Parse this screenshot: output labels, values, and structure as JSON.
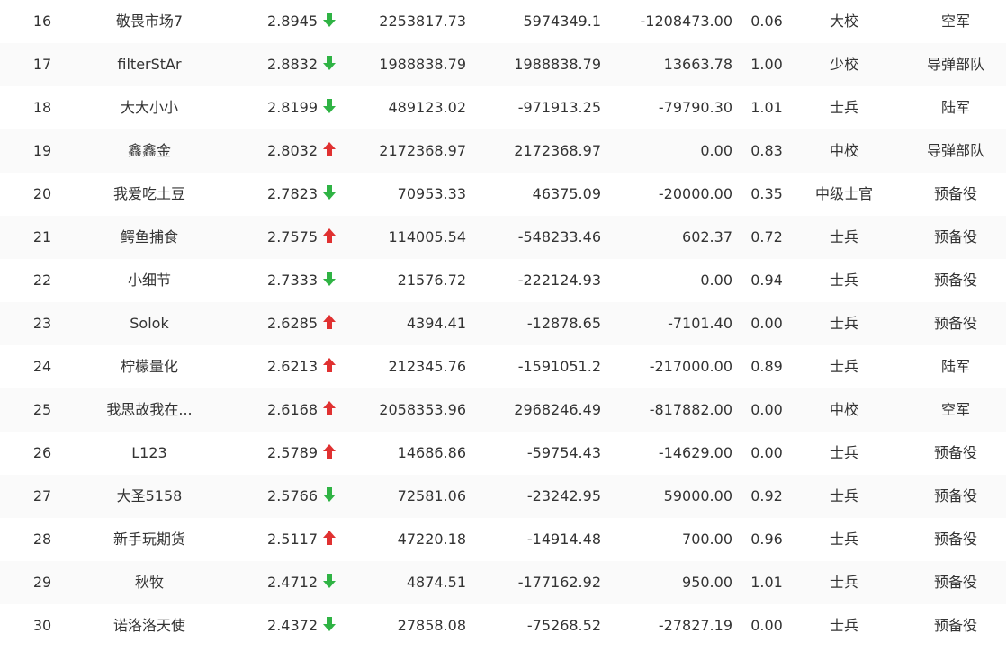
{
  "colors": {
    "up": "#e03131",
    "down": "#2fb344",
    "text": "#333333"
  },
  "rows": [
    {
      "rank": "16",
      "name": "敬畏市场7",
      "score": "2.8945",
      "trend": "down",
      "trend_icon": "arrow-down-icon",
      "v1": "2253817.73",
      "v2": "5974349.1",
      "v3": "-1208473.00",
      "ratio": "0.06",
      "level": "大校",
      "branch": "空军"
    },
    {
      "rank": "17",
      "name": "filterStAr",
      "score": "2.8832",
      "trend": "down",
      "trend_icon": "arrow-down-icon",
      "v1": "1988838.79",
      "v2": "1988838.79",
      "v3": "13663.78",
      "ratio": "1.00",
      "level": "少校",
      "branch": "导弹部队"
    },
    {
      "rank": "18",
      "name": "大大小小",
      "score": "2.8199",
      "trend": "down",
      "trend_icon": "arrow-down-icon",
      "v1": "489123.02",
      "v2": "-971913.25",
      "v3": "-79790.30",
      "ratio": "1.01",
      "level": "士兵",
      "branch": "陆军"
    },
    {
      "rank": "19",
      "name": "鑫鑫金",
      "score": "2.8032",
      "trend": "up",
      "trend_icon": "arrow-up-icon",
      "v1": "2172368.97",
      "v2": "2172368.97",
      "v3": "0.00",
      "ratio": "0.83",
      "level": "中校",
      "branch": "导弹部队"
    },
    {
      "rank": "20",
      "name": "我爱吃土豆",
      "score": "2.7823",
      "trend": "down",
      "trend_icon": "arrow-down-icon",
      "v1": "70953.33",
      "v2": "46375.09",
      "v3": "-20000.00",
      "ratio": "0.35",
      "level": "中级士官",
      "branch": "预备役"
    },
    {
      "rank": "21",
      "name": "鳄鱼捕食",
      "score": "2.7575",
      "trend": "up",
      "trend_icon": "arrow-up-icon",
      "v1": "114005.54",
      "v2": "-548233.46",
      "v3": "602.37",
      "ratio": "0.72",
      "level": "士兵",
      "branch": "预备役"
    },
    {
      "rank": "22",
      "name": "小细节",
      "score": "2.7333",
      "trend": "down",
      "trend_icon": "arrow-down-icon",
      "v1": "21576.72",
      "v2": "-222124.93",
      "v3": "0.00",
      "ratio": "0.94",
      "level": "士兵",
      "branch": "预备役"
    },
    {
      "rank": "23",
      "name": "Solok",
      "score": "2.6285",
      "trend": "up",
      "trend_icon": "arrow-up-icon",
      "v1": "4394.41",
      "v2": "-12878.65",
      "v3": "-7101.40",
      "ratio": "0.00",
      "level": "士兵",
      "branch": "预备役"
    },
    {
      "rank": "24",
      "name": "柠檬量化",
      "score": "2.6213",
      "trend": "up",
      "trend_icon": "arrow-up-icon",
      "v1": "212345.76",
      "v2": "-1591051.2",
      "v3": "-217000.00",
      "ratio": "0.89",
      "level": "士兵",
      "branch": "陆军"
    },
    {
      "rank": "25",
      "name": "我思故我在...",
      "score": "2.6168",
      "trend": "up",
      "trend_icon": "arrow-up-icon",
      "v1": "2058353.96",
      "v2": "2968246.49",
      "v3": "-817882.00",
      "ratio": "0.00",
      "level": "中校",
      "branch": "空军"
    },
    {
      "rank": "26",
      "name": "L123",
      "score": "2.5789",
      "trend": "up",
      "trend_icon": "arrow-up-icon",
      "v1": "14686.86",
      "v2": "-59754.43",
      "v3": "-14629.00",
      "ratio": "0.00",
      "level": "士兵",
      "branch": "预备役"
    },
    {
      "rank": "27",
      "name": "大圣5158",
      "score": "2.5766",
      "trend": "down",
      "trend_icon": "arrow-down-icon",
      "v1": "72581.06",
      "v2": "-23242.95",
      "v3": "59000.00",
      "ratio": "0.92",
      "level": "士兵",
      "branch": "预备役"
    },
    {
      "rank": "28",
      "name": "新手玩期货",
      "score": "2.5117",
      "trend": "up",
      "trend_icon": "arrow-up-icon",
      "v1": "47220.18",
      "v2": "-14914.48",
      "v3": "700.00",
      "ratio": "0.96",
      "level": "士兵",
      "branch": "预备役"
    },
    {
      "rank": "29",
      "name": "秋牧",
      "score": "2.4712",
      "trend": "down",
      "trend_icon": "arrow-down-icon",
      "v1": "4874.51",
      "v2": "-177162.92",
      "v3": "950.00",
      "ratio": "1.01",
      "level": "士兵",
      "branch": "预备役"
    },
    {
      "rank": "30",
      "name": "诺洛洛天使",
      "score": "2.4372",
      "trend": "down",
      "trend_icon": "arrow-down-icon",
      "v1": "27858.08",
      "v2": "-75268.52",
      "v3": "-27827.19",
      "ratio": "0.00",
      "level": "士兵",
      "branch": "预备役"
    }
  ]
}
